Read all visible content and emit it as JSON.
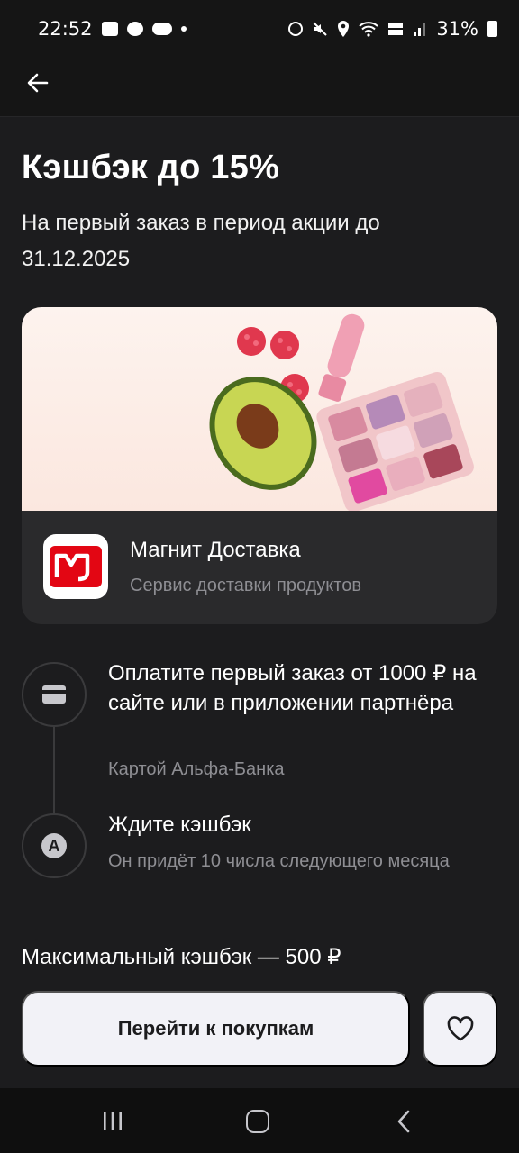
{
  "status_bar": {
    "time": "22:52",
    "battery": "31%",
    "icons_left": [
      "gallery-icon",
      "chat-icon",
      "wear-icon",
      "dot-icon"
    ],
    "icons_right": [
      "alarm-icon",
      "mute-icon",
      "location-icon",
      "wifi-icon",
      "volte-icon",
      "signal-icon",
      "battery-icon"
    ]
  },
  "header": {
    "back_icon": "arrow-left-icon"
  },
  "offer": {
    "title": "Кэшбэк до 15%",
    "subtitle": "На первый заказ в период акции до 31.12.2025"
  },
  "partner": {
    "name": "Магнит Доставка",
    "description": "Сервис доставки продуктов",
    "brand_color": "#e30613"
  },
  "steps": [
    {
      "title": "Оплатите первый заказ от 1000 ₽ на сайте или в приложении партнёра",
      "subtitle": "Картой Альфа-Банка",
      "icon": "card-icon"
    },
    {
      "title": "Ждите кэшбэк",
      "subtitle": "Он придёт 10 числа следующего месяца",
      "icon": "alfa-a-icon",
      "icon_letter": "A"
    }
  ],
  "max_cashback": "Максимальный кэшбэк — 500 ₽",
  "actions": {
    "primary_label": "Перейти к покупкам",
    "favorite_icon": "heart-icon"
  },
  "nav": {
    "recents": "recents-icon",
    "home": "home-icon",
    "back": "back-icon"
  }
}
